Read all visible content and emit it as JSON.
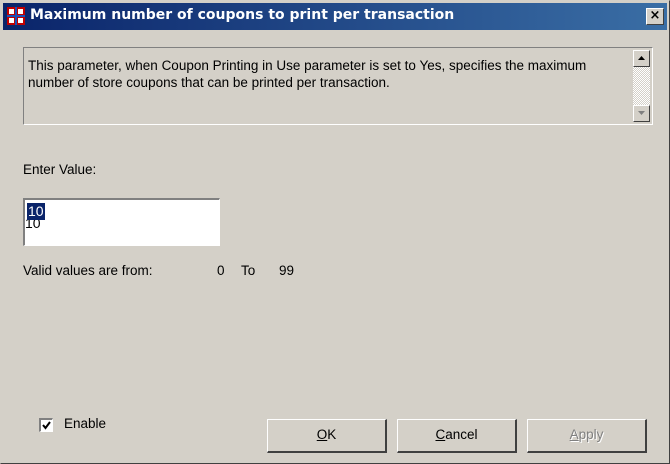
{
  "window": {
    "title": "Maximum number of coupons to print per transaction",
    "close_label": "×"
  },
  "description": {
    "text": "This parameter, when Coupon Printing in Use parameter is set to Yes, specifies the maximum number of store coupons that can be printed per transaction."
  },
  "form": {
    "enter_value_label": "Enter Value:",
    "value": "10",
    "valid_label": "Valid values are from:",
    "min": "0",
    "to_label": "To",
    "max": "99"
  },
  "footer": {
    "enable_label": "Enable",
    "enable_checked": true,
    "ok_mnemonic": "O",
    "ok_rest": "K",
    "cancel_mnemonic": "C",
    "cancel_rest": "ancel",
    "apply_mnemonic": "A",
    "apply_rest": "pply"
  },
  "icons": {
    "app": "app-icon",
    "close": "close-icon",
    "scroll_up": "chevron-up-icon",
    "scroll_down": "chevron-down-icon",
    "check": "checkmark-icon"
  },
  "colors": {
    "title_bar": "#0a246a",
    "face": "#d4d0c8",
    "selection": "#0a246a"
  }
}
